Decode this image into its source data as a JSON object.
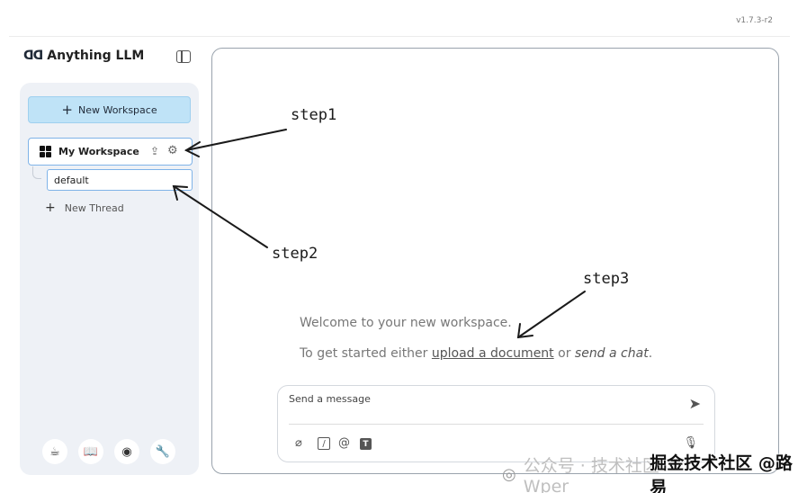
{
  "version": "v1.7.3-r2",
  "brand": {
    "logo": "ᗡᗡ",
    "name": "Anything LLM"
  },
  "sidebar": {
    "new_workspace_label": "New Workspace",
    "workspace_name": "My Workspace",
    "thread_name": "default",
    "new_thread_label": "New Thread"
  },
  "main": {
    "welcome_text": "Welcome to your new workspace.",
    "getstarted_prefix": "To get started either ",
    "upload_link": "upload a document",
    "or_text": " or ",
    "send_chat": "send a chat",
    "period": ".",
    "message_placeholder": "Send a message"
  },
  "annotations": {
    "step1": "step1",
    "step2": "step2",
    "step3": "step3"
  },
  "watermark": {
    "faded": "公众号 · 技术社区 Wper",
    "main": "掘金技术社区 @路易"
  },
  "icons": {
    "plus": "+",
    "upload": "⇪",
    "gear": "⚙",
    "send": "➤",
    "clip": "⌀",
    "slash": "/",
    "at": "@",
    "text": "T",
    "mic": "🎙",
    "footer": [
      "☕",
      "📖",
      "◉",
      "🔧"
    ]
  }
}
